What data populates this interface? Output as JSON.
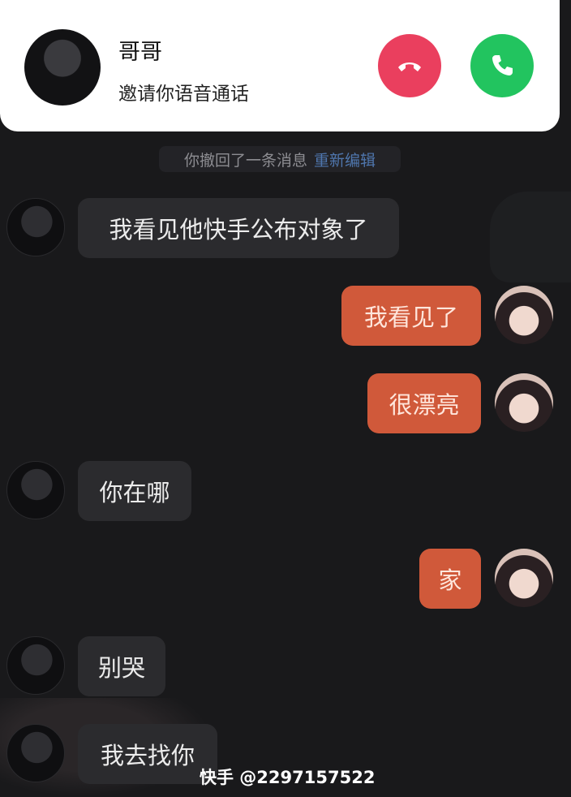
{
  "call": {
    "caller_name": "哥哥",
    "subtitle": "邀请你语音通话",
    "decline_icon": "phone-hangup-icon",
    "accept_icon": "phone-icon",
    "decline_color": "#ea3f5e",
    "accept_color": "#22c45f"
  },
  "notice": {
    "text": "你撤回了一条消息",
    "link": "重新编辑"
  },
  "messages": [
    {
      "from": "other",
      "text": "我看见他快手公布对象了"
    },
    {
      "from": "me",
      "text": "我看见了"
    },
    {
      "from": "me",
      "text": "很漂亮"
    },
    {
      "from": "other",
      "text": "你在哪"
    },
    {
      "from": "me",
      "text": "家"
    },
    {
      "from": "other",
      "text": "别哭"
    },
    {
      "from": "other",
      "text": "我去找你"
    }
  ],
  "colors": {
    "background": "#19191b",
    "sent_bubble": "#d0593a",
    "received_bubble": "#2b2b2e",
    "link": "#4f76ad"
  },
  "watermark": "快手 @2297157522"
}
